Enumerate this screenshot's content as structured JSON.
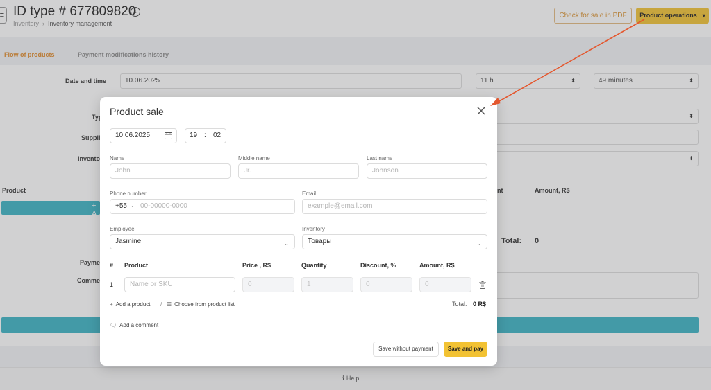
{
  "header": {
    "title": "ID type # 677809820",
    "breadcrumb": [
      "Inventory",
      "Inventory management"
    ],
    "pdf_button": "Check for sale in PDF",
    "operations_button": "Product operations"
  },
  "tabs": [
    "Flow of products",
    "Payment modifications history"
  ],
  "background_form": {
    "date_label": "Date and time",
    "date_value": "10.06.2025",
    "hour_value": "11 h",
    "minute_value": "49 minutes",
    "type_label": "Typ",
    "supplier_label": "Suppli",
    "inventory_label": "Invento",
    "product_col": "Product",
    "quantity_col_fragment": "nt",
    "amount_col": "Amount, R$",
    "add_btn_fragment": "+ A",
    "total_label": "Total:",
    "total_value": "0",
    "payment_label": "Payme",
    "comment_label": "Comme",
    "help": "Help"
  },
  "modal": {
    "title": "Product sale",
    "date": "10.06.2025",
    "hour": "19",
    "minute": "02",
    "name_label": "Name",
    "name_ph": "John",
    "middle_label": "Middle name",
    "middle_ph": "Jr.",
    "last_label": "Last name",
    "last_ph": "Johnson",
    "phone_label": "Phone number",
    "phone_code": "+55",
    "phone_ph": "00-00000-0000",
    "email_label": "Email",
    "email_ph": "example@email.com",
    "employee_label": "Employee",
    "employee_value": "Jasmine",
    "inventory_label": "Inventory",
    "inventory_value": "Товары",
    "table_headers": [
      "#",
      "Product",
      "Price , R$",
      "Quantity",
      "Discount, %",
      "Amount, R$"
    ],
    "row": {
      "num": "1",
      "product_ph": "Name or SKU",
      "price": "0",
      "quantity": "1",
      "discount": "0",
      "amount": "0"
    },
    "add_product": "Add a product",
    "sep": "/",
    "choose_list": "Choose from product list",
    "total_label": "Total:",
    "total_value": "0 R$",
    "add_comment": "Add a comment",
    "save_no_pay": "Save without payment",
    "save_pay": "Save and pay"
  },
  "colors": {
    "accent": "#f2c233",
    "tab_active": "#e08a2a",
    "teal": "#3bb3c4",
    "arrow": "#e4572e"
  }
}
